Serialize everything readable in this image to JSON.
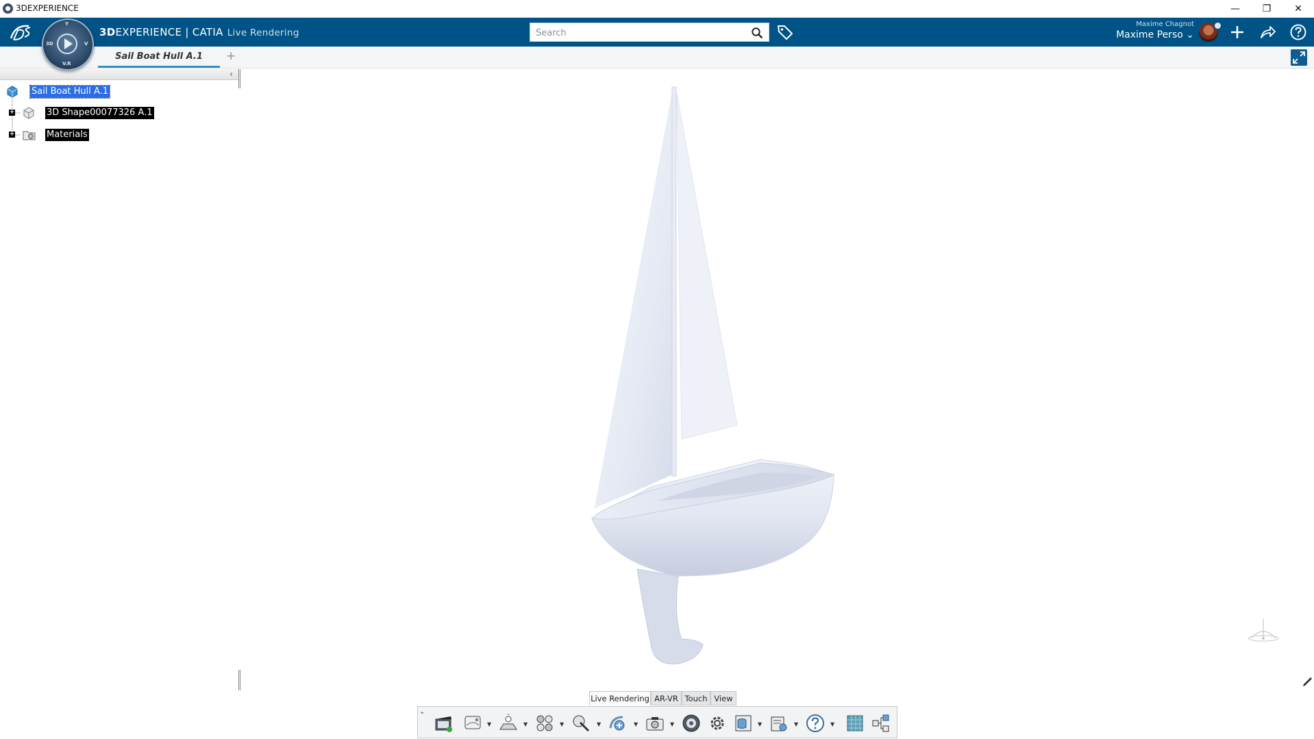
{
  "window": {
    "title": "3DEXPERIENCE",
    "controls": [
      "minimize",
      "restore",
      "close"
    ]
  },
  "header": {
    "brand_bold": "3D",
    "brand_rest": "EXPERIENCE | CATIA",
    "app_name": "Live Rendering",
    "compass_labels": {
      "top": "Y",
      "left": "3D",
      "right": "V",
      "bottom": "V.R"
    },
    "search_placeholder": "Search",
    "user_small": "Maxime Chagnot",
    "user_name": "Maxime Perso",
    "icons": [
      "ds-logo-icon",
      "search-icon",
      "tag-icon",
      "avatar",
      "plus-icon",
      "share-icon",
      "help-icon"
    ]
  },
  "tabs": {
    "active": "Sail Boat Hull A.1",
    "add": "+"
  },
  "tree": {
    "collapse_glyph": "‹",
    "items": [
      {
        "label": "Sail Boat Hull A.1",
        "icon": "product-icon",
        "selected": "blue"
      },
      {
        "label": "3D Shape00077326 A.1",
        "icon": "3d-shape-icon",
        "selected": "black"
      },
      {
        "label": "Materials",
        "icon": "materials-folder-icon",
        "selected": "black"
      }
    ]
  },
  "bottom_tabs": {
    "items": [
      "Live Rendering",
      "AR-VR",
      "Touch",
      "View"
    ],
    "active": "Live Rendering"
  },
  "toolbar": {
    "toggle": "⌄",
    "tools": [
      "animation-icon",
      "environment-icon",
      "lighting-icon",
      "materials-icon",
      "appearance-icon",
      "add-camera-icon",
      "capture-icon",
      "render-icon",
      "settings-icon",
      "database-icon",
      "configure-icon",
      "help-icon",
      "texture-icon",
      "structure-icon"
    ]
  },
  "colors": {
    "header_blue": "#005386",
    "tab_underline": "#368ec4",
    "selection_blue": "#2a6de6"
  }
}
